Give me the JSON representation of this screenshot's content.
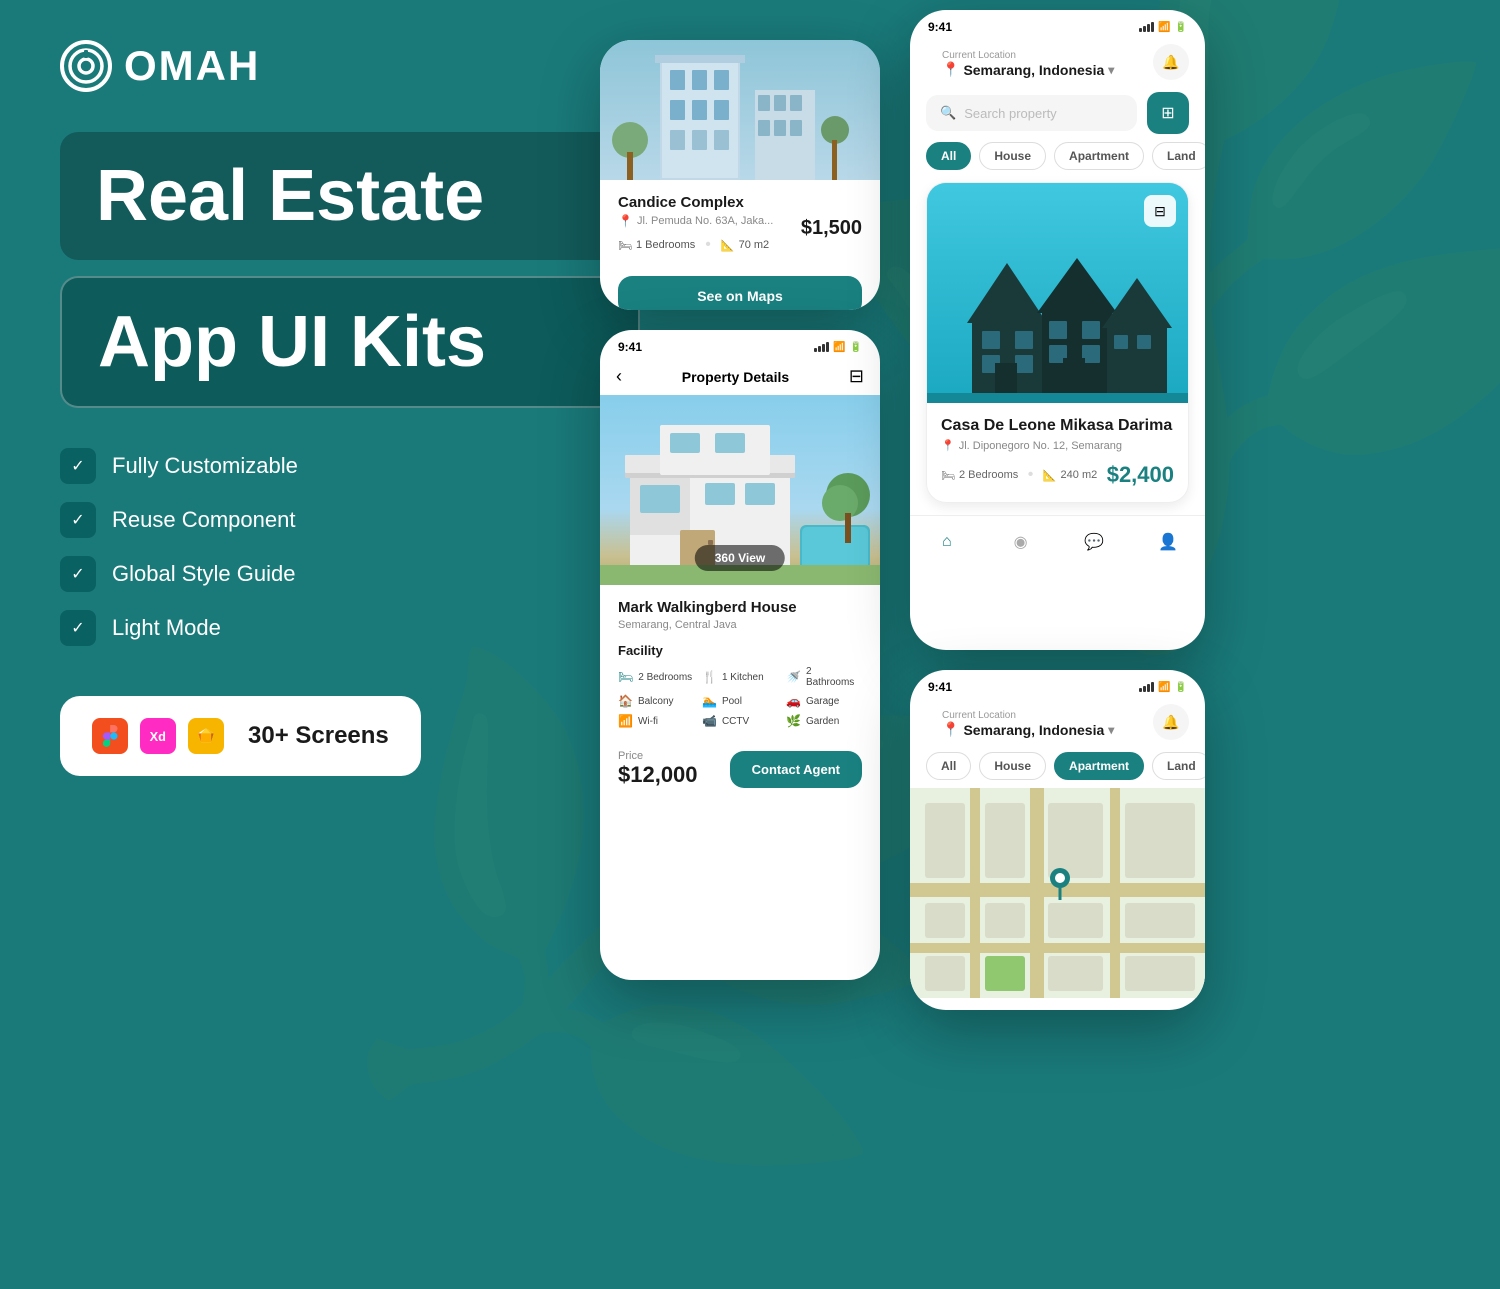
{
  "logo": {
    "icon": "◎",
    "text": "OMAH"
  },
  "hero": {
    "line1": "Real Estate",
    "line2": "App UI Kits"
  },
  "features": [
    {
      "id": "customizable",
      "label": "Fully Customizable"
    },
    {
      "id": "reuse",
      "label": "Reuse Component"
    },
    {
      "id": "style",
      "label": "Global Style Guide"
    },
    {
      "id": "light",
      "label": "Light Mode"
    }
  ],
  "badge": {
    "screens_count": "30+ Screens"
  },
  "phone_listing": {
    "property_name": "Candice Complex",
    "address": "Jl. Pemuda No. 63A, Jaka...",
    "bedrooms": "1 Bedrooms",
    "area": "70 m2",
    "price": "$1,500",
    "cta": "See on Maps"
  },
  "phone_details": {
    "time": "9:41",
    "title": "Property Details",
    "view360": "360 View",
    "property_name": "Mark Walkingberd House",
    "location": "Semarang, Central Java",
    "facility_title": "Facility",
    "facilities": [
      {
        "icon": "🛏",
        "label": "2 Bedrooms"
      },
      {
        "icon": "🍴",
        "label": "1 Kitchen"
      },
      {
        "icon": "🚿",
        "label": "2 Bathrooms"
      },
      {
        "icon": "🏠",
        "label": "Balcony"
      },
      {
        "icon": "🏊",
        "label": "Pool"
      },
      {
        "icon": "🚗",
        "label": "Garage"
      },
      {
        "icon": "📶",
        "label": "Wi-fi"
      },
      {
        "icon": "📹",
        "label": "CCTV"
      },
      {
        "icon": "🌿",
        "label": "Garden"
      }
    ],
    "price_label": "Price",
    "price_value": "$12,000",
    "cta": "Contact Agent"
  },
  "phone_search": {
    "time": "9:41",
    "loc_label": "Current Location",
    "loc_value": "Semarang, Indonesia",
    "search_placeholder": "Search property",
    "filter_tabs": [
      "All",
      "House",
      "Apartment",
      "Land"
    ],
    "active_tab": "All",
    "card": {
      "name": "Casa De Leone Mikasa Darima",
      "address": "Jl. Diponegoro No. 12, Semarang",
      "bedrooms": "2 Bedrooms",
      "area": "240 m2",
      "price": "$2,400"
    }
  },
  "phone_map": {
    "time": "9:41",
    "loc_label": "Current Location",
    "loc_value": "Semarang, Indonesia",
    "filter_tabs": [
      "All",
      "House",
      "Apartment",
      "Land"
    ],
    "active_tab": "Apartment"
  },
  "colors": {
    "teal": "#1a8080",
    "bg": "#1a7a7a",
    "white": "#ffffff"
  }
}
